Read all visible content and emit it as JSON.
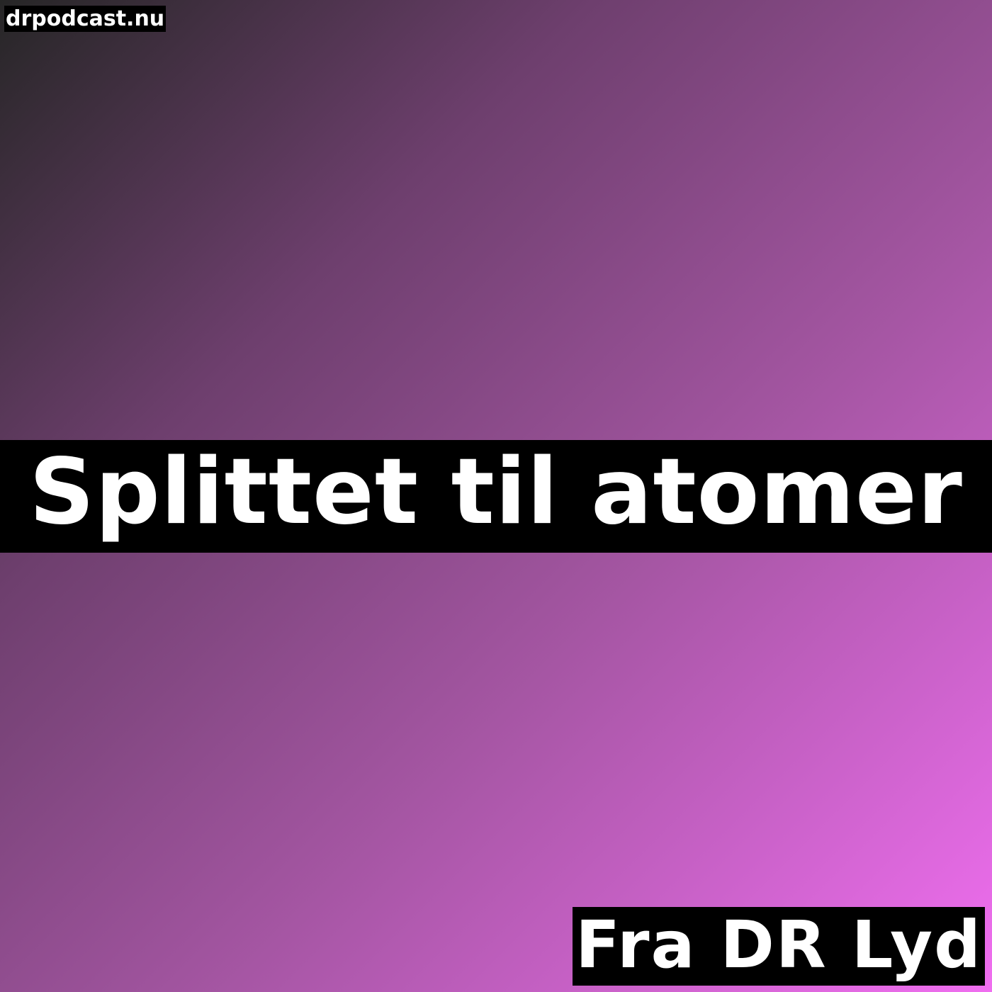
{
  "site": {
    "label": "drpodcast.nu"
  },
  "podcast": {
    "title": "Splittet til atomer",
    "source": "Fra DR Lyd"
  },
  "colors": {
    "gradient_start": "#262626",
    "gradient_mid": "#a355a1",
    "gradient_end": "#f06ef0",
    "label_background": "#000000",
    "label_text": "#ffffff"
  }
}
